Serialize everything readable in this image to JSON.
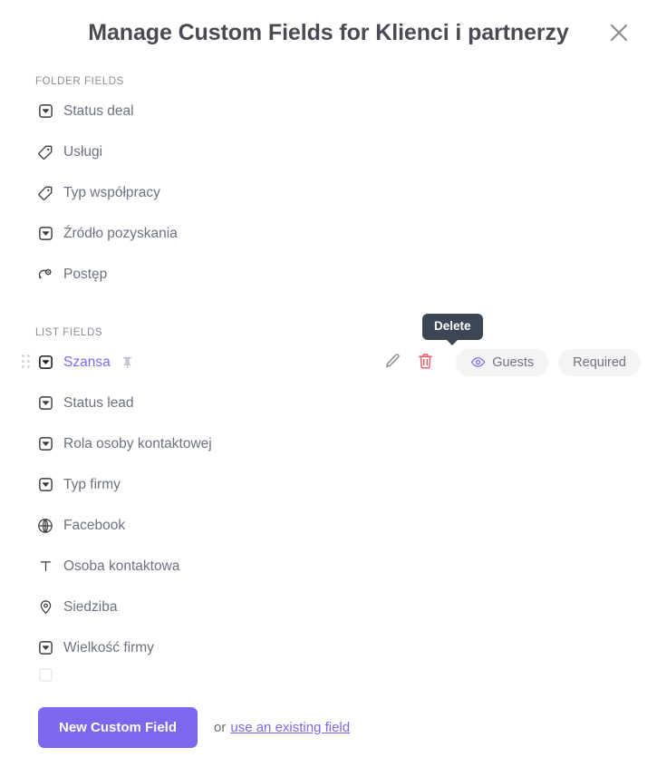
{
  "header": {
    "title": "Manage Custom Fields for Klienci i partnerzy",
    "close_icon": "close-icon"
  },
  "sections": [
    {
      "heading": "FOLDER FIELDS",
      "fields": [
        {
          "label": "Status deal",
          "icon": "dropdown-icon"
        },
        {
          "label": "Usługi",
          "icon": "tag-icon"
        },
        {
          "label": "Typ współpracy",
          "icon": "tag-icon"
        },
        {
          "label": "Źródło pozyskania",
          "icon": "dropdown-icon"
        },
        {
          "label": "Postęp",
          "icon": "progress-icon"
        }
      ]
    },
    {
      "heading": "LIST FIELDS",
      "fields": [
        {
          "label": "Szansa",
          "icon": "dropdown-icon",
          "active": true,
          "pinned": true
        },
        {
          "label": "Status lead",
          "icon": "dropdown-icon"
        },
        {
          "label": "Rola osoby kontaktowej",
          "icon": "dropdown-icon"
        },
        {
          "label": "Typ firmy",
          "icon": "dropdown-icon"
        },
        {
          "label": "Facebook",
          "icon": "globe-icon"
        },
        {
          "label": "Osoba kontaktowa",
          "icon": "text-icon"
        },
        {
          "label": "Siedziba",
          "icon": "location-pin-icon"
        },
        {
          "label": "Wielkość firmy",
          "icon": "dropdown-icon"
        }
      ]
    }
  ],
  "row_actions": {
    "edit_icon": "pencil-icon",
    "delete_icon": "trash-icon",
    "guests_label": "Guests",
    "guests_icon": "eye-icon",
    "required_label": "Required"
  },
  "tooltip": {
    "text": "Delete"
  },
  "footer": {
    "new_field_label": "New Custom Field",
    "or_text": "or",
    "existing_field_link": "use an existing field"
  },
  "colors": {
    "accent": "#7b68ee",
    "delete": "#ea5a63",
    "tooltip_bg": "#3c4654",
    "label": "#6b7280",
    "title": "#4a4a55"
  }
}
